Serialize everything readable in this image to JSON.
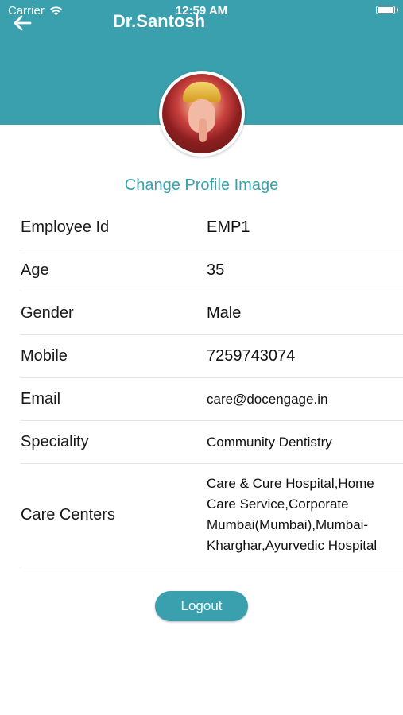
{
  "status_bar": {
    "carrier": "Carrier",
    "time": "12:59 AM"
  },
  "nav": {
    "title": "Dr.Santosh"
  },
  "profile": {
    "change_image_label": "Change Profile Image"
  },
  "details": [
    {
      "label": "Employee Id",
      "value": "EMP1"
    },
    {
      "label": "Age",
      "value": "35"
    },
    {
      "label": "Gender",
      "value": "Male"
    },
    {
      "label": "Mobile",
      "value": "7259743074"
    },
    {
      "label": "Email",
      "value": "care@docengage.in"
    },
    {
      "label": "Speciality",
      "value": "Community Dentistry"
    },
    {
      "label": "Care Centers",
      "value": "Care & Cure Hospital,Home Care Service,Corporate Mumbai(Mumbai),Mumbai-Kharghar,Ayurvedic Hospital"
    }
  ],
  "actions": {
    "logout_label": "Logout"
  },
  "colors": {
    "accent": "#3aa0ad",
    "divider": "#e4e4e4"
  },
  "icons": {
    "back": "back-arrow-icon",
    "wifi": "wifi-icon",
    "battery": "battery-icon"
  }
}
